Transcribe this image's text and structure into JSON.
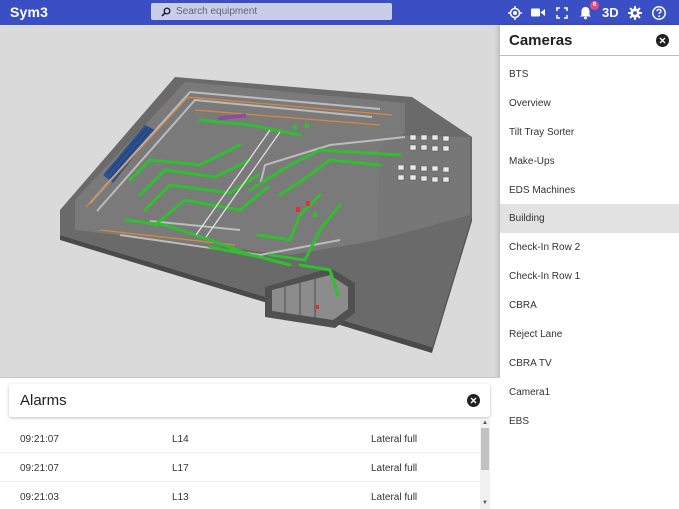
{
  "app": {
    "brand": "Sym3"
  },
  "search": {
    "placeholder": "Search equipment"
  },
  "toolbar": {
    "notifications_count": "6",
    "view_mode_label": "3D"
  },
  "icons": {
    "locate": "crosshair-icon",
    "camera": "video-camera-icon",
    "fullscreen": "fullscreen-icon",
    "notifications": "bell-icon",
    "settings": "gear-icon",
    "help": "help-icon"
  },
  "colors": {
    "topbar": "#3b4fc4",
    "badge": "#e84a7a",
    "conveyor_active": "#2fbf2f",
    "conveyor_alarm": "#e03030"
  },
  "cameras": {
    "title": "Cameras",
    "selected": "Building",
    "items": [
      {
        "label": "BTS"
      },
      {
        "label": "Overview"
      },
      {
        "label": "Tilt Tray Sorter"
      },
      {
        "label": "Make-Ups"
      },
      {
        "label": "EDS Machines"
      },
      {
        "label": "Building"
      },
      {
        "label": "Check-In Row 2"
      },
      {
        "label": "Check-In Row 1"
      },
      {
        "label": "CBRA"
      },
      {
        "label": "Reject Lane"
      },
      {
        "label": "CBRA TV"
      },
      {
        "label": "Camera1"
      },
      {
        "label": "EBS"
      }
    ]
  },
  "alarms": {
    "title": "Alarms",
    "rows": [
      {
        "time": "09:21:07",
        "code": "L14",
        "message": "Lateral full"
      },
      {
        "time": "09:21:07",
        "code": "L17",
        "message": "Lateral full"
      },
      {
        "time": "09:21:03",
        "code": "L13",
        "message": "Lateral full"
      }
    ]
  }
}
